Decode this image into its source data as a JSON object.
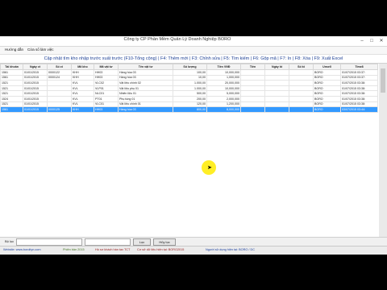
{
  "window": {
    "title": "Công ty CP Phần Mềm Quản Lý Doanh Nghiệp BORO"
  },
  "menu": [
    "Hướng dẫn",
    "Cửa sổ làm việc"
  ],
  "hint": "Cập nhật tìm kho nhập trước xuất trước (F10-Tổng cộng) | F4: Thêm mới | F3: Chỉnh sửa | F5: Tìm kiếm | F6: Gộp mã | F7: In | F8: Xóa | F9: Xuất Excel",
  "grid": {
    "columns": [
      "Tài khoản",
      "Ngày ct",
      "Số ct",
      "Mã kho",
      "Mã vật tư",
      "Tên vật tư",
      "Số lượng",
      "Tiền VNĐ",
      "Tiền",
      "Ngày kt",
      "Số kt",
      "Unsell",
      "Time8"
    ],
    "rows": [
      [
        "1561",
        "01/01/2015",
        "0000122",
        "KHH",
        "HH03",
        "Hàng hóa 03",
        "100,00",
        "10,000,000",
        "",
        "",
        "",
        "BORO",
        "01/07/2015 03:37:"
      ],
      [
        "1561",
        "01/01/2015",
        "0000124",
        "KHH",
        "HH03",
        "Hàng hóa 03",
        "10,00",
        "1,000,000",
        "",
        "",
        "",
        "BORO",
        "01/07/2015 03:37:"
      ],
      [
        "1521",
        "01/01/2015",
        "",
        "KVL",
        "VLC02",
        "Vật liệu chính 02",
        "1.000,00",
        "20,000,000",
        "",
        "",
        "",
        "BORO",
        "01/07/2015 03:38:"
      ],
      [
        "1521",
        "01/01/2015",
        "",
        "KVL",
        "VLP01",
        "Vật liệu phụ 01",
        "1.000,00",
        "10,000,000",
        "",
        "",
        "",
        "BORO",
        "01/07/2015 03:38:"
      ],
      [
        "1521",
        "01/01/2015",
        "",
        "KVL",
        "NLC01",
        "Nhiên liệu 01",
        "500,00",
        "5,000,000",
        "",
        "",
        "",
        "BORO",
        "01/07/2015 03:38:"
      ],
      [
        "1524",
        "01/01/2015",
        "",
        "KVL",
        "PT01",
        "Phụ tùng 01",
        "200,00",
        "2,000,000",
        "",
        "",
        "",
        "BORO",
        "01/07/2015 03:38:"
      ],
      [
        "1521",
        "01/01/2015",
        "",
        "KVL",
        "VLC01",
        "Vật liệu chính 01",
        "120,00",
        "1,200,000",
        "",
        "",
        "",
        "BORO",
        "01/07/2015 03:38:"
      ],
      [
        "1561",
        "01/01/2015",
        "0000125",
        "KHH",
        "HH03",
        "Hàng hóa 03",
        "800,00",
        "8,000,000",
        "",
        "",
        "",
        "BORO",
        "03/07/2015 03:44:"
      ]
    ]
  },
  "filter": {
    "label": "Bộ lọc",
    "search_button": "Lọc",
    "all_button": "Hủy lọc"
  },
  "status": [
    "Website: www.boroltyn.com",
    "Phiên bản 2015",
    "Hồ sơ khách hàn tax TCT",
    "Cơ sở dữ liệu hiện tại: BORO2015",
    "Người sử dụng hiện tại: BORO / DC"
  ]
}
